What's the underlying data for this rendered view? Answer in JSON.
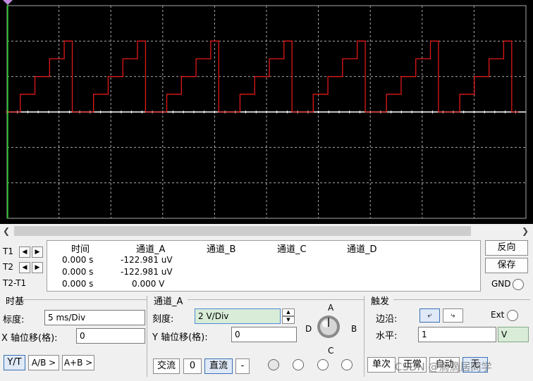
{
  "colors": {
    "screen_bg": "#000000",
    "grid": "#a8a8a8",
    "trace_a": "#e01818",
    "cursor": "#12c712",
    "axis": "#ffffff"
  },
  "scope_trace": {
    "channel": "A",
    "waveform": "staircase",
    "steps_per_period": 4,
    "periods_visible": 7,
    "volts_per_div": 2,
    "step_levels_div": [
      0,
      0.5,
      1,
      1.5,
      2
    ]
  },
  "readout": {
    "rows": [
      {
        "label": "T1",
        "time": "0.000 s",
        "channel_a": "-122.981 uV"
      },
      {
        "label": "T2",
        "time": "0.000 s",
        "channel_a": "-122.981 uV"
      },
      {
        "label": "T2-T1",
        "time": "0.000 s",
        "channel_a": "0.000 V"
      }
    ],
    "headers": {
      "time": "时间",
      "channel_a": "通道_A",
      "channel_b": "通道_B",
      "channel_c": "通道_C",
      "channel_d": "通道_D"
    },
    "reverse_label": "反向",
    "save_label": "保存",
    "gnd_label": "GND"
  },
  "timebase": {
    "title": "时基",
    "scale_label": "标度:",
    "scale_value": "5 ms/Div",
    "xpos_label": "X 轴位移(格):",
    "xpos_value": "0",
    "mode_yt": "Y/T",
    "mode_ab": "A/B >",
    "mode_apb": "A+B >"
  },
  "channel_a": {
    "title": "通道_A",
    "scale_label": "刻度:",
    "scale_value": "2  V/Div",
    "ypos_label": "Y 轴位移(格):",
    "ypos_value": "0",
    "ac_label": "交流",
    "zero_label": "0",
    "dc_label": "直流",
    "minus_label": "-",
    "knob_labels": {
      "a": "A",
      "b": "B",
      "c": "C",
      "d": "D"
    }
  },
  "trigger": {
    "title": "触发",
    "edge_label": "边沿:",
    "level_label": "水平:",
    "level_value": "1",
    "level_unit": "V",
    "ext_label": "Ext",
    "single_label": "单次",
    "normal_label": "正常",
    "auto_label": "自动",
    "none_label": "无"
  },
  "watermark": "CSDN @滴滴居同学"
}
